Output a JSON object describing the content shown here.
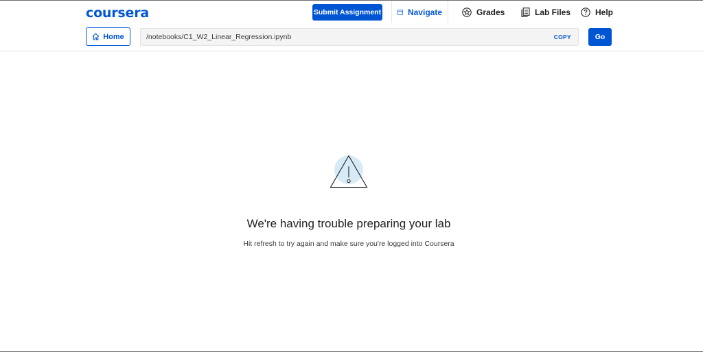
{
  "header": {
    "logo": "coursera",
    "submit_label": "Submit Assignment",
    "nav": [
      {
        "label": "Navigate",
        "icon": "browser-window-icon",
        "active": true
      },
      {
        "label": "Grades",
        "icon": "star-circle-icon"
      },
      {
        "label": "Lab Files",
        "icon": "files-icon"
      },
      {
        "label": "Help",
        "icon": "question-circle-icon"
      }
    ]
  },
  "toolbar": {
    "home_label": "Home",
    "path_value": "/notebooks/C1_W2_Linear_Regression.ipynb",
    "copy_label": "COPY",
    "go_label": "Go"
  },
  "error": {
    "title": "We're having trouble preparing your lab",
    "subtitle": "Hit refresh to try again and make sure you're logged into Coursera"
  },
  "colors": {
    "brand": "#0056d2",
    "warning_circle": "#d7ebf7"
  }
}
